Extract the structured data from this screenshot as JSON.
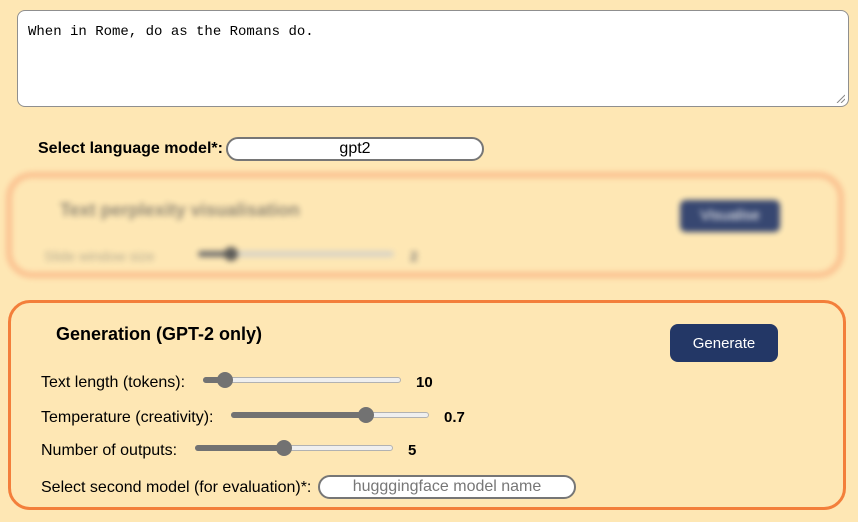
{
  "prompt": {
    "text": "When in Rome, do as the Romans do."
  },
  "language_model": {
    "label": "Select language model*:",
    "value": "gpt2"
  },
  "perplexity_panel": {
    "title": "Text perplexity visualisation",
    "button_label": "Visualise",
    "slider_label": "Slide window size",
    "slider_value": "2",
    "slider_fraction": 0.16
  },
  "generation": {
    "title": "Generation (GPT-2 only)",
    "button_label": "Generate",
    "text_length": {
      "label": "Text length (tokens):",
      "value": "10",
      "fraction": 0.11
    },
    "temperature": {
      "label": "Temperature (creativity):",
      "value": "0.7",
      "fraction": 0.68
    },
    "num_outputs": {
      "label": "Number of outputs:",
      "value": "5",
      "fraction": 0.45
    },
    "second_model": {
      "label": "Select second model (for evaluation)*:",
      "placeholder": "hugggingface model name"
    }
  },
  "colors": {
    "background": "#fee7b4",
    "accent_border": "#f37f3b",
    "button": "#233766"
  }
}
